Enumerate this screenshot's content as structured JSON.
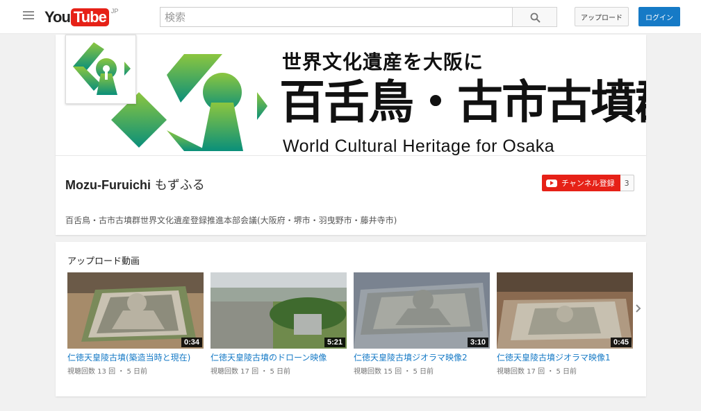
{
  "masthead": {
    "logo_you": "You",
    "logo_tube": "Tube",
    "logo_region": "JP",
    "search_placeholder": "検索",
    "upload_label": "アップロード",
    "login_label": "ログイン"
  },
  "banner": {
    "line1": "世界文化遺産を大阪に",
    "line2": "百舌鳥・古市古墳群",
    "line3": "World Cultural Heritage for Osaka"
  },
  "channel": {
    "name_en": "Mozu-Furuichi",
    "name_jp": "もずふる",
    "subscribe_label": "チャンネル登録",
    "subscriber_count": "3",
    "description": "百舌鳥・古市古墳群世界文化遺産登録推進本部会議(大阪府・堺市・羽曳野市・藤井寺市)"
  },
  "uploads": {
    "title": "アップロード動画",
    "videos": [
      {
        "title": "仁徳天皇陵古墳(築造当時と現在)",
        "duration": "0:34",
        "meta": "視聴回数 13 回 ・ 5 日前"
      },
      {
        "title": "仁徳天皇陵古墳のドローン映像",
        "duration": "5:21",
        "meta": "視聴回数 17 回 ・ 5 日前"
      },
      {
        "title": "仁徳天皇陵古墳ジオラマ映像2",
        "duration": "3:10",
        "meta": "視聴回数 15 回 ・ 5 日前"
      },
      {
        "title": "仁徳天皇陵古墳ジオラマ映像1",
        "duration": "0:45",
        "meta": "視聴回数 17 回 ・ 5 日前"
      }
    ]
  },
  "colors": {
    "brand_red": "#e62117",
    "link_blue": "#167ac6",
    "logo_green": "#5bb531",
    "logo_teal": "#0a8f7a"
  },
  "icons": {
    "menu": "hamburger-icon",
    "search": "search-icon",
    "subscribe": "youtube-play-icon",
    "next": "chevron-right-icon"
  }
}
